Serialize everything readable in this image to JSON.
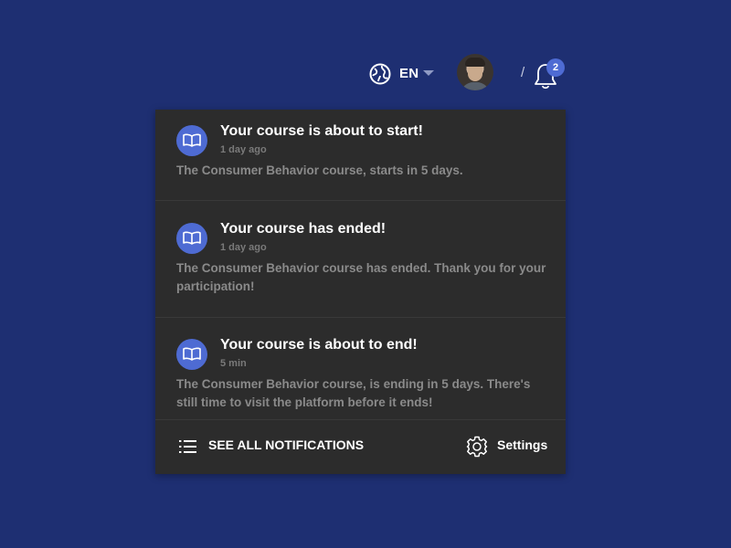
{
  "header": {
    "language": "EN",
    "notification_count": "2",
    "separator": "/"
  },
  "notifications": [
    {
      "title": "Your course is about to start!",
      "time": "1 day ago",
      "message": "The Consumer Behavior course, starts in 5 days."
    },
    {
      "title": "Your course has ended!",
      "time": "1 day ago",
      "message": "The Consumer Behavior course has ended. Thank you for your participation!"
    },
    {
      "title": "Your course is about to end!",
      "time": "5 min",
      "message": "The Consumer Behavior course, is ending in 5 days. There's still time to visit the platform before it ends!"
    }
  ],
  "footer": {
    "see_all_label": "SEE ALL NOTIFICATIONS",
    "settings_label": "Settings"
  },
  "colors": {
    "background": "#1e2f72",
    "panel": "#2c2c2c",
    "accent": "#4e6bd3"
  },
  "icons": {
    "language": "globe-icon",
    "dropdown": "chevron-down-icon",
    "notifications": "bell-icon",
    "notification_item": "book-icon",
    "see_all": "list-icon",
    "settings": "gear-icon"
  }
}
